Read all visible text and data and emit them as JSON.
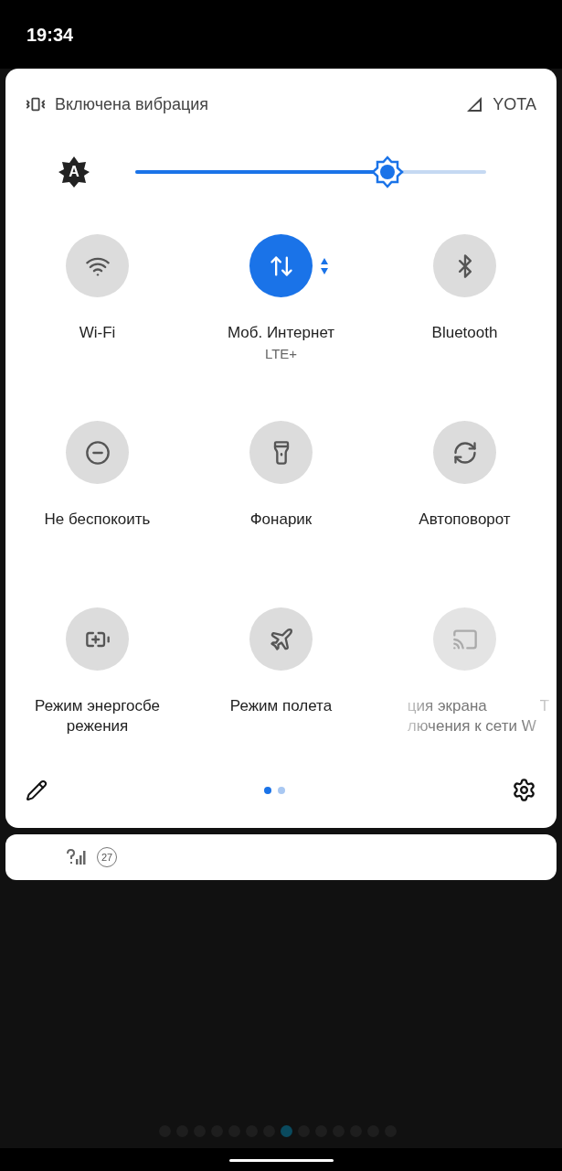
{
  "status_bar": {
    "time": "19:34"
  },
  "panel": {
    "ringer": "Включена вибрация",
    "carrier": "YOTA",
    "brightness": {
      "auto_glyph": "A",
      "level": 0.72
    },
    "tiles": [
      {
        "label": [
          "Wi-Fi"
        ],
        "on": false,
        "disabled": false
      },
      {
        "label": [
          "Моб. Интернет"
        ],
        "sublabel": "LTE+",
        "on": true,
        "disabled": false,
        "dropdown": true
      },
      {
        "label": [
          "Bluetooth"
        ],
        "on": false,
        "disabled": false
      },
      {
        "label": [
          "Не беспокоить"
        ],
        "on": false,
        "disabled": false
      },
      {
        "label": [
          "Фонарик"
        ],
        "on": false,
        "disabled": false
      },
      {
        "label": [
          "Автоповорот"
        ],
        "on": false,
        "disabled": false
      },
      {
        "label": [
          "Режим энергосбе",
          "режения"
        ],
        "on": false,
        "disabled": false
      },
      {
        "label": [
          "Режим полета"
        ],
        "on": false,
        "disabled": false
      },
      {
        "label": [
          "ция экрана",
          "лючения к сети W"
        ],
        "trailing": "Т",
        "on": false,
        "disabled": true
      }
    ],
    "pages": [
      {
        "selected": true
      },
      {
        "selected": false
      }
    ]
  },
  "notification": {
    "badge": "27"
  },
  "background_pager": [
    {
      "selected": false
    },
    {
      "selected": false
    },
    {
      "selected": false
    },
    {
      "selected": false
    },
    {
      "selected": false
    },
    {
      "selected": false
    },
    {
      "selected": false
    },
    {
      "selected": true
    },
    {
      "selected": false
    },
    {
      "selected": false
    },
    {
      "selected": false
    },
    {
      "selected": false
    },
    {
      "selected": false
    },
    {
      "selected": false
    }
  ]
}
